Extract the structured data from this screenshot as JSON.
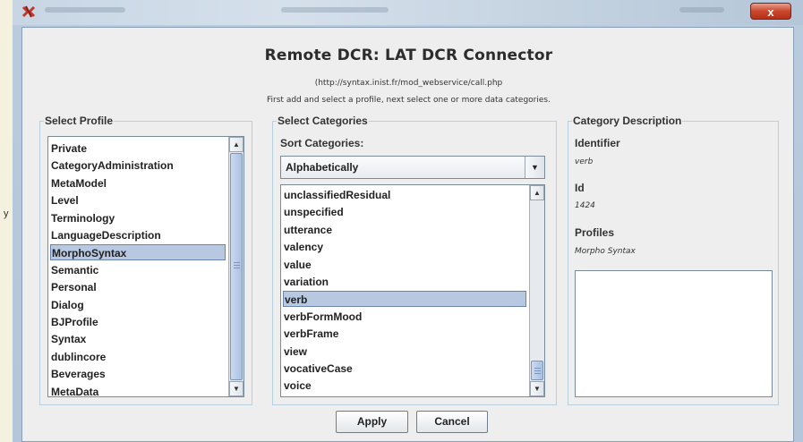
{
  "window": {
    "close_glyph": "x"
  },
  "header": {
    "title": "Remote DCR: LAT DCR Connector",
    "url": "(http://syntax.inist.fr/mod_webservice/call.php",
    "instruction": "First add and select a profile, next select one or more data categories."
  },
  "profile_panel": {
    "title": "Select Profile",
    "items": [
      {
        "label": "Private",
        "selected": false
      },
      {
        "label": "CategoryAdministration",
        "selected": false
      },
      {
        "label": "MetaModel",
        "selected": false
      },
      {
        "label": "Level",
        "selected": false
      },
      {
        "label": "Terminology",
        "selected": false
      },
      {
        "label": "LanguageDescription",
        "selected": false
      },
      {
        "label": "MorphoSyntax",
        "selected": true
      },
      {
        "label": "Semantic",
        "selected": false
      },
      {
        "label": "Personal",
        "selected": false
      },
      {
        "label": "Dialog",
        "selected": false
      },
      {
        "label": "BJProfile",
        "selected": false
      },
      {
        "label": "Syntax",
        "selected": false
      },
      {
        "label": "dublincore",
        "selected": false
      },
      {
        "label": "Beverages",
        "selected": false
      },
      {
        "label": "MetaData",
        "selected": false
      }
    ]
  },
  "categories_panel": {
    "title": "Select Categories",
    "sort_label": "Sort Categories:",
    "sort_value": "Alphabetically",
    "items": [
      {
        "label": "unclassifiedResidual",
        "selected": false
      },
      {
        "label": "unspecified",
        "selected": false
      },
      {
        "label": "utterance",
        "selected": false
      },
      {
        "label": "valency",
        "selected": false
      },
      {
        "label": "value",
        "selected": false
      },
      {
        "label": "variation",
        "selected": false
      },
      {
        "label": "verb",
        "selected": true
      },
      {
        "label": "verbFormMood",
        "selected": false
      },
      {
        "label": "verbFrame",
        "selected": false
      },
      {
        "label": "view",
        "selected": false
      },
      {
        "label": "vocativeCase",
        "selected": false
      },
      {
        "label": "voice",
        "selected": false
      }
    ]
  },
  "description_panel": {
    "title": "Category Description",
    "identifier_label": "Identifier",
    "identifier_value": "verb",
    "id_label": "Id",
    "id_value": "1424",
    "profiles_label": "Profiles",
    "profiles_value": "Morpho Syntax"
  },
  "buttons": {
    "apply": "Apply",
    "cancel": "Cancel"
  },
  "colors": {
    "selection": "#b8c8e0",
    "close_button": "#c9462b"
  }
}
